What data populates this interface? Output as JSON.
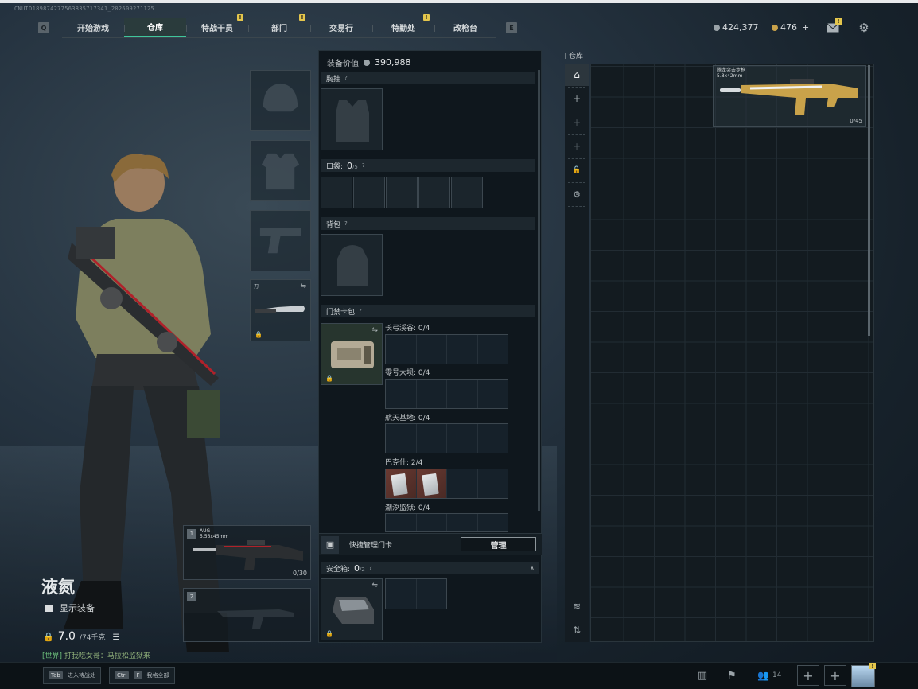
{
  "uid_text": "CNUID1898742775638357173­41_202609271125",
  "nav": {
    "left_key": "Q",
    "right_key": "E",
    "tabs": [
      {
        "label": "开始游戏",
        "active": false,
        "alert": false
      },
      {
        "label": "仓库",
        "active": true,
        "alert": false
      },
      {
        "label": "特战干员",
        "active": false,
        "alert": true
      },
      {
        "label": "部门",
        "active": false,
        "alert": true
      },
      {
        "label": "交易行",
        "active": false,
        "alert": false
      },
      {
        "label": "特勤处",
        "active": false,
        "alert": true
      },
      {
        "label": "改枪台",
        "active": false,
        "alert": false
      }
    ],
    "alert_mark": "!"
  },
  "currency": {
    "silver": "424,377",
    "gold": "476",
    "gold_add": "+"
  },
  "character": {
    "name": "液氮",
    "show_equipment_label": "显示装备",
    "weight": "7.0",
    "weight_max": "/74千克",
    "chat_channel": "[世界]",
    "chat_text": "打我吃女哥：马拉松监狱来"
  },
  "equipment": {
    "melee_label": "刀",
    "swap_glyph": "⇋",
    "lock_glyph": "🔒",
    "primary": {
      "slot": "1",
      "name": "AUG",
      "caliber": "5.56x45mm",
      "ammo": "0/30"
    },
    "secondary": {
      "slot": "2"
    }
  },
  "loadout": {
    "value_label": "装备价值",
    "value": "390,988",
    "chest_label": "胸挂",
    "pocket_label": "口袋:",
    "pocket_count": "0",
    "pocket_max": "/5",
    "backpack_label": "背包",
    "keycard_label": "门禁卡包",
    "help": "?",
    "keycard_rows": [
      {
        "label": "长弓溪谷: 0/4",
        "filled": 0
      },
      {
        "label": "零号大坝: 0/4",
        "filled": 0
      },
      {
        "label": "航天基地: 0/4",
        "filled": 0
      },
      {
        "label": "巴克什: 2/4",
        "filled": 2
      },
      {
        "label": "潮汐监狱: 0/4",
        "filled": 0
      }
    ],
    "quick_manage_label": "快捷管理门卡",
    "manage_button": "管理",
    "safebox_label": "安全箱:",
    "safebox_count": "0",
    "safebox_max": "/2",
    "pin_glyph": "📌"
  },
  "warehouse": {
    "title": "仓库",
    "item": {
      "name": "腾龙突击步枪",
      "caliber": "5.8x42mm",
      "ammo": "0/45"
    }
  },
  "footer": {
    "tab_key": "Tab",
    "tab_label": "进入待战处",
    "ctrl_key": "Ctrl",
    "f_key": "F",
    "ctrl_label": "我格全部",
    "friends_count": "14"
  },
  "colors": {
    "accent": "#3fc59c",
    "alert": "#e4c64c",
    "gold": "#c9a24a"
  }
}
